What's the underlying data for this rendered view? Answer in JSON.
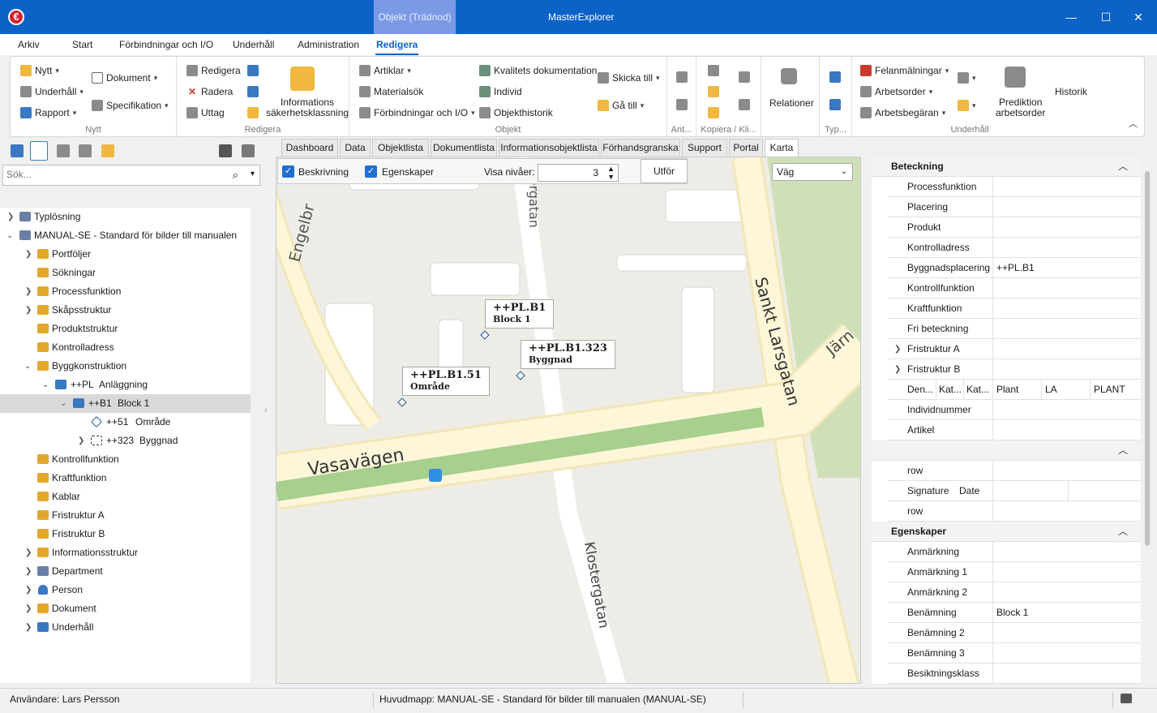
{
  "window": {
    "title": "MasterExplorer",
    "context_tab": "Objekt (Trädnod)",
    "logo": "€"
  },
  "menu": [
    "Arkiv",
    "Start",
    "Förbindningar och I/O",
    "Underhåll",
    "Administration",
    "Redigera"
  ],
  "ribbon": {
    "nytt": {
      "nytt": "Nytt",
      "underhall": "Underhåll",
      "rapport": "Rapport",
      "dokument": "Dokument",
      "specifikation": "Specifikation",
      "label": "Nytt"
    },
    "redigera": {
      "redigera": "Redigera",
      "radera": "Radera",
      "uttag": "Uttag",
      "info_line1": "Informations",
      "info_line2": "säkerhetsklassning",
      "label": "Redigera"
    },
    "objekt": {
      "artiklar": "Artiklar",
      "materialsok": "Materialsök",
      "forbindningar": "Förbindningar och I/O",
      "kvalitet": "Kvalitets dokumentation",
      "individ": "Individ",
      "objekthistorik": "Objekthistorik",
      "skicka": "Skicka till",
      "ga": "Gå till",
      "label": "Objekt"
    },
    "ant_label": "Ant...",
    "kopiera_label": "Kopiera / Kli...",
    "relationer": "Relationer",
    "typ_label": "Typ...",
    "underhall": {
      "felanmalningar": "Felanmälningar",
      "arbetsorder": "Arbetsorder",
      "arbetsbegaran": "Arbetsbegäran",
      "prediktion_line1": "Prediktion",
      "prediktion_line2": "arbetsorder",
      "historik": "Historik",
      "label": "Underhåll"
    }
  },
  "search": {
    "placeholder": "Sök..."
  },
  "tree": [
    {
      "label": "Typlösning"
    },
    {
      "label": "MANUAL-SE - Standard för bilder till manualen"
    },
    {
      "label": "Portföljer"
    },
    {
      "label": "Sökningar"
    },
    {
      "label": "Processfunktion"
    },
    {
      "label": "Skåpsstruktur"
    },
    {
      "label": "Produktstruktur"
    },
    {
      "label": "Kontrolladress"
    },
    {
      "label": "Byggkonstruktion"
    },
    {
      "label": "++PL",
      "name": "Anläggning"
    },
    {
      "label": "++B1",
      "name": "Block 1"
    },
    {
      "label": "++51",
      "name": "Område"
    },
    {
      "label": "++323",
      "name": "Byggnad"
    },
    {
      "label": "Kontrollfunktion"
    },
    {
      "label": "Kraftfunktion"
    },
    {
      "label": "Kablar"
    },
    {
      "label": "Fristruktur A"
    },
    {
      "label": "Fristruktur B"
    },
    {
      "label": "Informationsstruktur"
    },
    {
      "label": "Department"
    },
    {
      "label": "Person"
    },
    {
      "label": "Dokument"
    },
    {
      "label": "Underhåll"
    }
  ],
  "tabs": [
    "Dashboard",
    "Data",
    "Objektlista",
    "Dokumentlista",
    "Informationsobjektlista",
    "Förhandsgranska",
    "Support",
    "Portal",
    "Karta"
  ],
  "map_toolbar": {
    "beskrivning": "Beskrivning",
    "egenskaper": "Egenskaper",
    "visa_nivaer": "Visa nivåer:",
    "levels": "3",
    "utfor": "Utför",
    "layer": "Väg"
  },
  "map": {
    "streets": [
      "Engelbr",
      "stergatan",
      "Sankt Larsgatan",
      "Järn",
      "Vasavägen",
      "Klostergatan"
    ],
    "markers": [
      {
        "title": "++PL.B1",
        "subtitle": "Block 1"
      },
      {
        "title": "++PL.B1.323",
        "subtitle": "Byggnad"
      },
      {
        "title": "++PL.B1.51",
        "subtitle": "Område"
      }
    ]
  },
  "properties": {
    "beteckning_title": "Beteckning",
    "beteckning_rows": [
      {
        "name": "Processfunktion",
        "value": ""
      },
      {
        "name": "Placering",
        "value": ""
      },
      {
        "name": "Produkt",
        "value": ""
      },
      {
        "name": "Kontrolladress",
        "value": ""
      },
      {
        "name": "Byggnadsplacering",
        "value": "++PL.B1"
      },
      {
        "name": "Kontrollfunktion",
        "value": ""
      },
      {
        "name": "Kraftfunktion",
        "value": ""
      },
      {
        "name": "Fri beteckning",
        "value": ""
      },
      {
        "name": "Fristruktur A",
        "value": ""
      },
      {
        "name": "Fristruktur B",
        "value": ""
      }
    ],
    "den_row": {
      "c1": "Den...",
      "c2": "Kat...",
      "c3": "Kat...",
      "v1": "Plant",
      "v2": "LA",
      "v3": "PLANT"
    },
    "beteckning_rows2": [
      {
        "name": "Individnummer",
        "value": ""
      },
      {
        "name": "Artikel",
        "value": ""
      }
    ],
    "sec2_rows": [
      {
        "name": "row",
        "value": ""
      },
      {
        "name": "Signature",
        "name2": "Date",
        "value": ""
      },
      {
        "name": "row",
        "value": ""
      }
    ],
    "egenskaper_title": "Egenskaper",
    "egenskaper_rows": [
      {
        "name": "Anmärkning",
        "value": ""
      },
      {
        "name": "Anmärkning 1",
        "value": ""
      },
      {
        "name": "Anmärkning 2",
        "value": ""
      },
      {
        "name": "Benämning",
        "value": "Block 1"
      },
      {
        "name": "Benämning 2",
        "value": ""
      },
      {
        "name": "Benämning 3",
        "value": ""
      },
      {
        "name": "Besiktningsklass",
        "value": ""
      }
    ]
  },
  "status": {
    "user": "Användare: Lars Persson",
    "folder": "Huvudmapp: MANUAL-SE - Standard för bilder till manualen (MANUAL-SE)"
  },
  "colors": {
    "titlebar": "#0d62c7",
    "accent": "#0d62c7",
    "park": "#cfe0b8",
    "road": "#fdf6d8"
  }
}
